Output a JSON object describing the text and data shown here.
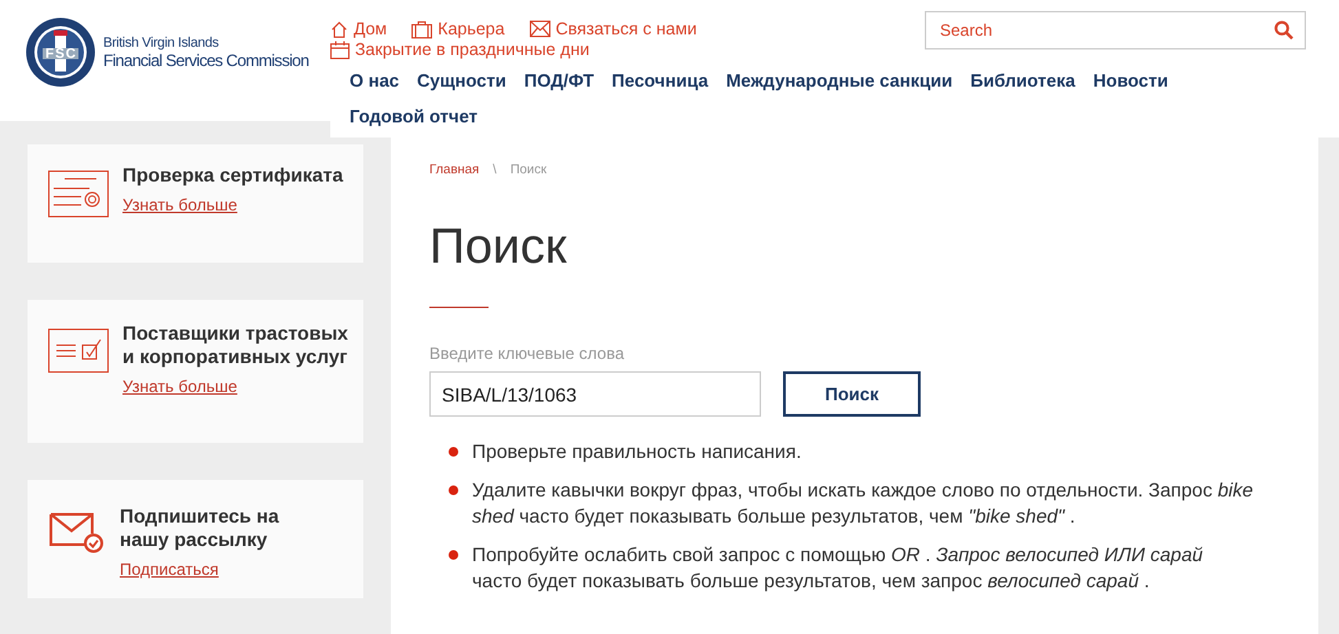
{
  "logo": {
    "line_1": "British Virgin Islands",
    "line_2": "Financial Services Commission",
    "badge": "FSC"
  },
  "top_links": [
    {
      "kind": "home",
      "label": "Дом"
    },
    {
      "kind": "briefcase",
      "label": "Карьера"
    },
    {
      "kind": "mail",
      "label": "Связаться с нами"
    },
    {
      "kind": "calendar",
      "label": "Закрытие в праздничные дни"
    }
  ],
  "search": {
    "placeholder": "Search"
  },
  "nav": [
    "О нас",
    "Сущности",
    "ПОД/ФТ",
    "Песочница",
    "Международные санкции",
    "Библиотека",
    "Новости",
    "Годовой отчет"
  ],
  "sidebar_cards": [
    {
      "kind": "certificate",
      "title": "Проверка сертификата",
      "link": "Узнать больше"
    },
    {
      "kind": "checklist",
      "title": "Поставщики трастовых и корпоративных услуг",
      "link": "Узнать больше"
    },
    {
      "kind": "envelope",
      "title": "Подпишитесь на нашу рассылку",
      "link": "Подписаться"
    }
  ],
  "breadcrumb": [
    {
      "label": "Главная",
      "selected": false
    },
    {
      "label": "Поиск",
      "selected": true
    }
  ],
  "breadcrumb_separator": "\\",
  "heading": "Поиск",
  "search_form": {
    "label": "Введите ключевые слова",
    "value": "SIBA/L/13/1063",
    "button": "Поиск"
  },
  "tips": [
    "Проверьте правильность написания.",
    "Удалите кавычки вокруг фраз, чтобы искать каждое слово по отдельности. Запрос *bike shed* часто будет показывать больше результатов, чем *\"bike shed\"* .",
    "Попробуйте ослабить свой запрос с помощью *OR* . *Запрос велосипед ИЛИ сарай* часто будет показывать больше результатов, чем запрос *велосипед сарай* ."
  ]
}
